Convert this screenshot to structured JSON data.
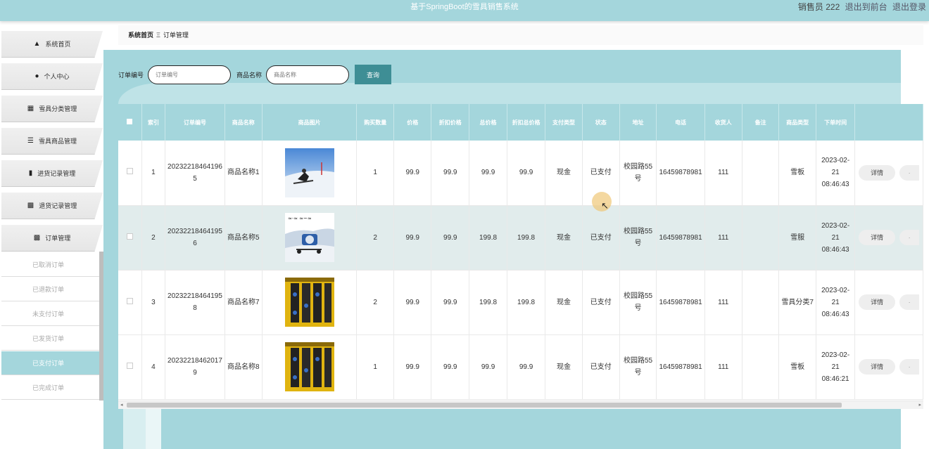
{
  "topbar": {
    "title": "基于SpringBoot的雪具销售系统",
    "user": "销售员 222",
    "to_front": "退出到前台",
    "logout": "退出登录"
  },
  "sidebar": {
    "items": [
      {
        "label": "系统首页",
        "icon": "home-icon"
      },
      {
        "label": "个人中心",
        "icon": "user-icon"
      },
      {
        "label": "雪具分类管理",
        "icon": "grid-icon"
      },
      {
        "label": "雪具商品管理",
        "icon": "list-icon"
      },
      {
        "label": "进货记录管理",
        "icon": "document-icon"
      },
      {
        "label": "退货记录管理",
        "icon": "grid4-icon"
      },
      {
        "label": "订单管理",
        "icon": "grid4-icon"
      }
    ],
    "sub_items": [
      "已取消订单",
      "已退款订单",
      "未支付订单",
      "已发货订单",
      "已支付订单",
      "已完成订单"
    ]
  },
  "breadcrumb": {
    "home": "系统首页",
    "current": "订单管理"
  },
  "search": {
    "order_no_label": "订单编号",
    "order_no_placeholder": "订单编号",
    "product_name_label": "商品名称",
    "product_name_placeholder": "商品名称",
    "query_button": "查询"
  },
  "table": {
    "headers": [
      "索引",
      "订单编号",
      "商品名称",
      "商品图片",
      "购买数量",
      "价格",
      "折扣价格",
      "总价格",
      "折扣总价格",
      "支付类型",
      "状态",
      "地址",
      "电话",
      "收货人",
      "备注",
      "商品类型",
      "下单时间"
    ],
    "detail_label": "详情",
    "rows": [
      {
        "index": "1",
        "order_no": "20232218464196 5",
        "name": "商品名称1",
        "qty": "1",
        "price": "99.9",
        "discount_price": "99.9",
        "total": "99.9",
        "discount_total": "99.9",
        "pay_type": "现金",
        "status": "已支付",
        "address": "校园路55号",
        "phone": "16459878981",
        "receiver": "111",
        "remark": "",
        "type": "雪板",
        "time": "2023-02-21 08:46:43"
      },
      {
        "index": "2",
        "order_no": "20232218464195 6",
        "name": "商品名称5",
        "qty": "2",
        "price": "99.9",
        "discount_price": "99.9",
        "total": "199.8",
        "discount_total": "199.8",
        "pay_type": "现金",
        "status": "已支付",
        "address": "校园路55号",
        "phone": "16459878981",
        "receiver": "111",
        "remark": "",
        "type": "雪服",
        "time": "2023-02-21 08:46:43"
      },
      {
        "index": "3",
        "order_no": "20232218464195 8",
        "name": "商品名称7",
        "qty": "2",
        "price": "99.9",
        "discount_price": "99.9",
        "total": "199.8",
        "discount_total": "199.8",
        "pay_type": "现金",
        "status": "已支付",
        "address": "校园路55号",
        "phone": "16459878981",
        "receiver": "111",
        "remark": "",
        "type": "雪具分类7",
        "time": "2023-02-21 08:46:43"
      },
      {
        "index": "4",
        "order_no": "20232218462017 9",
        "name": "商品名称8",
        "qty": "1",
        "price": "99.9",
        "discount_price": "99.9",
        "total": "99.9",
        "discount_total": "99.9",
        "pay_type": "现金",
        "status": "已支付",
        "address": "校园路55号",
        "phone": "16459878981",
        "receiver": "111",
        "remark": "",
        "type": "雪板",
        "time": "2023-02-21 08:46:21"
      }
    ]
  },
  "colors": {
    "accent": "#a4d6dc",
    "button": "#3e8e95"
  }
}
